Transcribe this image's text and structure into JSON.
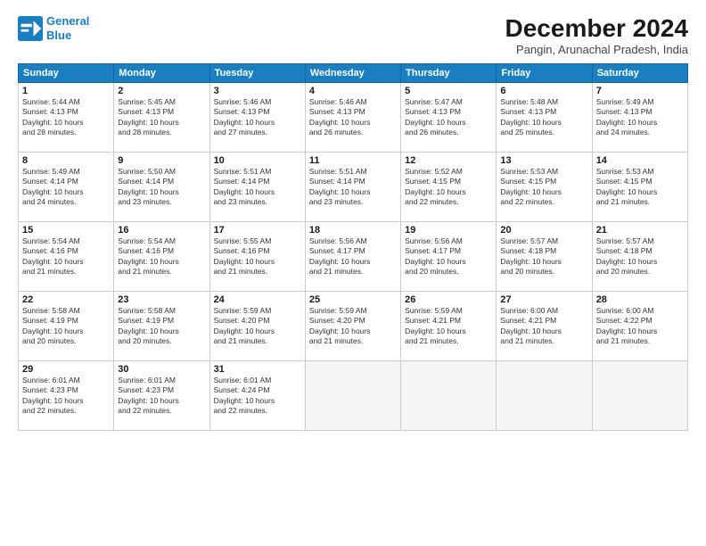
{
  "logo": {
    "line1": "General",
    "line2": "Blue"
  },
  "title": "December 2024",
  "subtitle": "Pangin, Arunachal Pradesh, India",
  "days_of_week": [
    "Sunday",
    "Monday",
    "Tuesday",
    "Wednesday",
    "Thursday",
    "Friday",
    "Saturday"
  ],
  "weeks": [
    [
      {
        "num": "1",
        "info": "Sunrise: 5:44 AM\nSunset: 4:13 PM\nDaylight: 10 hours\nand 28 minutes."
      },
      {
        "num": "2",
        "info": "Sunrise: 5:45 AM\nSunset: 4:13 PM\nDaylight: 10 hours\nand 28 minutes."
      },
      {
        "num": "3",
        "info": "Sunrise: 5:46 AM\nSunset: 4:13 PM\nDaylight: 10 hours\nand 27 minutes."
      },
      {
        "num": "4",
        "info": "Sunrise: 5:46 AM\nSunset: 4:13 PM\nDaylight: 10 hours\nand 26 minutes."
      },
      {
        "num": "5",
        "info": "Sunrise: 5:47 AM\nSunset: 4:13 PM\nDaylight: 10 hours\nand 26 minutes."
      },
      {
        "num": "6",
        "info": "Sunrise: 5:48 AM\nSunset: 4:13 PM\nDaylight: 10 hours\nand 25 minutes."
      },
      {
        "num": "7",
        "info": "Sunrise: 5:49 AM\nSunset: 4:13 PM\nDaylight: 10 hours\nand 24 minutes."
      }
    ],
    [
      {
        "num": "8",
        "info": "Sunrise: 5:49 AM\nSunset: 4:14 PM\nDaylight: 10 hours\nand 24 minutes."
      },
      {
        "num": "9",
        "info": "Sunrise: 5:50 AM\nSunset: 4:14 PM\nDaylight: 10 hours\nand 23 minutes."
      },
      {
        "num": "10",
        "info": "Sunrise: 5:51 AM\nSunset: 4:14 PM\nDaylight: 10 hours\nand 23 minutes."
      },
      {
        "num": "11",
        "info": "Sunrise: 5:51 AM\nSunset: 4:14 PM\nDaylight: 10 hours\nand 23 minutes."
      },
      {
        "num": "12",
        "info": "Sunrise: 5:52 AM\nSunset: 4:15 PM\nDaylight: 10 hours\nand 22 minutes."
      },
      {
        "num": "13",
        "info": "Sunrise: 5:53 AM\nSunset: 4:15 PM\nDaylight: 10 hours\nand 22 minutes."
      },
      {
        "num": "14",
        "info": "Sunrise: 5:53 AM\nSunset: 4:15 PM\nDaylight: 10 hours\nand 21 minutes."
      }
    ],
    [
      {
        "num": "15",
        "info": "Sunrise: 5:54 AM\nSunset: 4:16 PM\nDaylight: 10 hours\nand 21 minutes."
      },
      {
        "num": "16",
        "info": "Sunrise: 5:54 AM\nSunset: 4:16 PM\nDaylight: 10 hours\nand 21 minutes."
      },
      {
        "num": "17",
        "info": "Sunrise: 5:55 AM\nSunset: 4:16 PM\nDaylight: 10 hours\nand 21 minutes."
      },
      {
        "num": "18",
        "info": "Sunrise: 5:56 AM\nSunset: 4:17 PM\nDaylight: 10 hours\nand 21 minutes."
      },
      {
        "num": "19",
        "info": "Sunrise: 5:56 AM\nSunset: 4:17 PM\nDaylight: 10 hours\nand 20 minutes."
      },
      {
        "num": "20",
        "info": "Sunrise: 5:57 AM\nSunset: 4:18 PM\nDaylight: 10 hours\nand 20 minutes."
      },
      {
        "num": "21",
        "info": "Sunrise: 5:57 AM\nSunset: 4:18 PM\nDaylight: 10 hours\nand 20 minutes."
      }
    ],
    [
      {
        "num": "22",
        "info": "Sunrise: 5:58 AM\nSunset: 4:19 PM\nDaylight: 10 hours\nand 20 minutes."
      },
      {
        "num": "23",
        "info": "Sunrise: 5:58 AM\nSunset: 4:19 PM\nDaylight: 10 hours\nand 20 minutes."
      },
      {
        "num": "24",
        "info": "Sunrise: 5:59 AM\nSunset: 4:20 PM\nDaylight: 10 hours\nand 21 minutes."
      },
      {
        "num": "25",
        "info": "Sunrise: 5:59 AM\nSunset: 4:20 PM\nDaylight: 10 hours\nand 21 minutes."
      },
      {
        "num": "26",
        "info": "Sunrise: 5:59 AM\nSunset: 4:21 PM\nDaylight: 10 hours\nand 21 minutes."
      },
      {
        "num": "27",
        "info": "Sunrise: 6:00 AM\nSunset: 4:21 PM\nDaylight: 10 hours\nand 21 minutes."
      },
      {
        "num": "28",
        "info": "Sunrise: 6:00 AM\nSunset: 4:22 PM\nDaylight: 10 hours\nand 21 minutes."
      }
    ],
    [
      {
        "num": "29",
        "info": "Sunrise: 6:01 AM\nSunset: 4:23 PM\nDaylight: 10 hours\nand 22 minutes."
      },
      {
        "num": "30",
        "info": "Sunrise: 6:01 AM\nSunset: 4:23 PM\nDaylight: 10 hours\nand 22 minutes."
      },
      {
        "num": "31",
        "info": "Sunrise: 6:01 AM\nSunset: 4:24 PM\nDaylight: 10 hours\nand 22 minutes."
      },
      null,
      null,
      null,
      null
    ]
  ]
}
